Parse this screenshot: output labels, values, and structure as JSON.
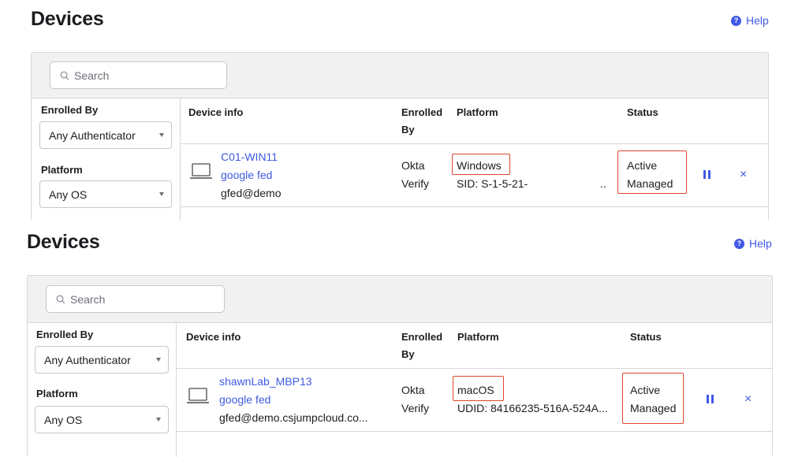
{
  "panels": [
    {
      "title": "Devices",
      "help_label": "Help",
      "search_placeholder": "Search",
      "filters": {
        "enrolled_by_label": "Enrolled By",
        "enrolled_by_value": "Any Authenticator",
        "platform_label": "Platform",
        "platform_value": "Any OS"
      },
      "columns": {
        "device_info": "Device info",
        "enrolled_by_line1": "Enrolled",
        "enrolled_by_line2": "By",
        "platform": "Platform",
        "status": "Status"
      },
      "row": {
        "device_name": "C01-WIN11",
        "user_name": "google fed",
        "user_email": "gfed@demo",
        "enrolled_line1": "Okta",
        "enrolled_line2": "Verify",
        "platform": "Windows",
        "platform_id": "SID: S-1-5-21-",
        "platform_id_more": "..",
        "status_line1": "Active",
        "status_line2": "Managed"
      }
    },
    {
      "title": "Devices",
      "help_label": "Help",
      "search_placeholder": "Search",
      "filters": {
        "enrolled_by_label": "Enrolled By",
        "enrolled_by_value": "Any Authenticator",
        "platform_label": "Platform",
        "platform_value": "Any OS"
      },
      "columns": {
        "device_info": "Device info",
        "enrolled_by_line1": "Enrolled",
        "enrolled_by_line2": "By",
        "platform": "Platform",
        "status": "Status"
      },
      "row": {
        "device_name": "shawnLab_MBP13",
        "user_name": "google fed",
        "user_email": "gfed@demo.csjumpcloud.co...",
        "enrolled_line1": "Okta",
        "enrolled_line2": "Verify",
        "platform": "macOS",
        "platform_id": "UDID: 84166235-516A-524A...",
        "platform_id_more": "",
        "status_line1": "Active",
        "status_line2": "Managed"
      }
    }
  ],
  "icons": {
    "help": "question-circle-icon",
    "search": "search-icon",
    "device": "laptop-icon",
    "suspend": "pause-icon",
    "deactivate": "close-icon"
  },
  "colors": {
    "accent": "#3f59e4",
    "highlight": "#e0452d",
    "panel_bg": "#f1f1f1"
  }
}
